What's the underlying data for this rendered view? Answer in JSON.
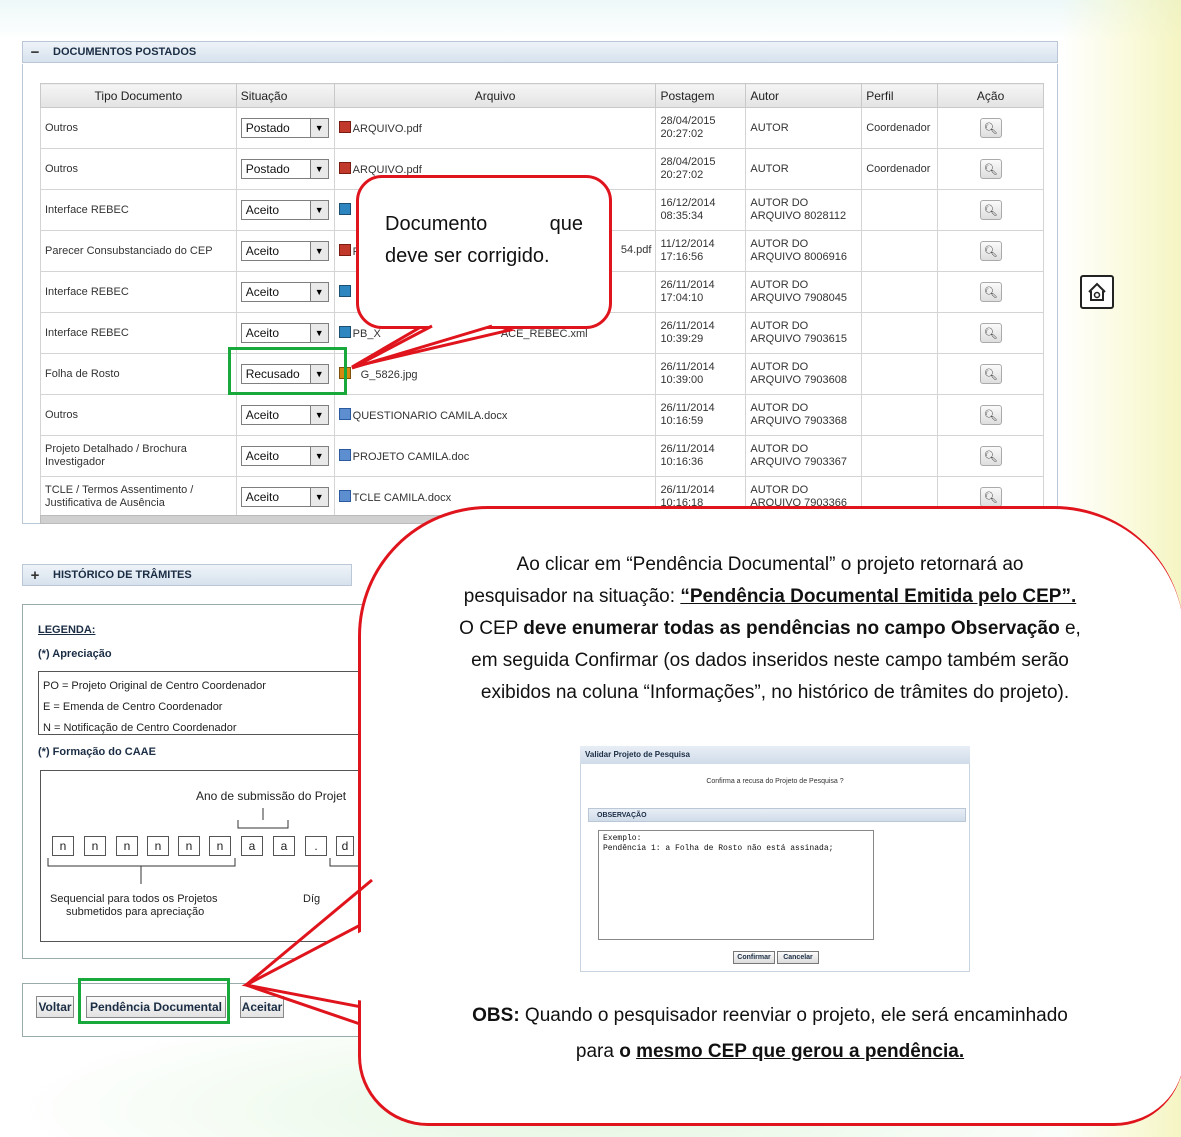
{
  "sections": {
    "docs_title": "DOCUMENTOS POSTADOS",
    "docs_toggle": "−",
    "hist_title": "HISTÓRICO DE TRÂMITES",
    "hist_toggle": "+"
  },
  "table": {
    "headers": [
      "Tipo Documento",
      "Situação",
      "Arquivo",
      "Postagem",
      "Autor",
      "Perfil",
      "Ação"
    ],
    "rows": [
      {
        "tipo": "Outros",
        "situacao": "Postado",
        "arquivo": "ARQUIVO.pdf",
        "icon": "pdf-icon",
        "data": "28/04/2015",
        "hora": "20:27:02",
        "autor1": "AUTOR",
        "autor2": "",
        "perfil": "Coordenador"
      },
      {
        "tipo": "Outros",
        "situacao": "Postado",
        "arquivo": "ARQUIVO.pdf",
        "icon": "pdf-icon",
        "data": "28/04/2015",
        "hora": "20:27:02",
        "autor1": "AUTOR",
        "autor2": "",
        "perfil": "Coordenador"
      },
      {
        "tipo": "Interface REBEC",
        "situacao": "Aceito",
        "arquivo": "",
        "icon": "xml-icon",
        "data": "16/12/2014",
        "hora": "08:35:34",
        "autor1": "AUTOR DO",
        "autor2": "ARQUIVO 8028112",
        "perfil": ""
      },
      {
        "tipo": "Parecer Consubstanciado do CEP",
        "situacao": "Aceito",
        "arquivo": "PI",
        "arquivo_end": "54.pdf",
        "icon": "pdf-icon",
        "data": "11/12/2014",
        "hora": "17:16:56",
        "autor1": "AUTOR DO",
        "autor2": "ARQUIVO 8006916",
        "perfil": ""
      },
      {
        "tipo": "Interface REBEC",
        "situacao": "Aceito",
        "arquivo": "",
        "icon": "xml-icon",
        "data": "26/11/2014",
        "hora": "17:04:10",
        "autor1": "AUTOR DO",
        "autor2": "ARQUIVO 7908045",
        "perfil": ""
      },
      {
        "tipo": "Interface REBEC",
        "situacao": "Aceito",
        "arquivo": "PB_X",
        "arquivo_end": "ACE_REBEC.xml",
        "icon": "xml-icon",
        "data": "26/11/2014",
        "hora": "10:39:29",
        "autor1": "AUTOR DO",
        "autor2": "ARQUIVO 7903615",
        "perfil": ""
      },
      {
        "tipo": "Folha de Rosto",
        "situacao": "Recusado",
        "arquivo": "G_5826.jpg",
        "icon": "image-icon",
        "data": "26/11/2014",
        "hora": "10:39:00",
        "autor1": "AUTOR DO",
        "autor2": "ARQUIVO 7903608",
        "perfil": ""
      },
      {
        "tipo": "Outros",
        "situacao": "Aceito",
        "arquivo": "QUESTIONARIO CAMILA.docx",
        "icon": "doc-icon",
        "data": "26/11/2014",
        "hora": "10:16:59",
        "autor1": "AUTOR DO",
        "autor2": "ARQUIVO 7903368",
        "perfil": ""
      },
      {
        "tipo": "Projeto Detalhado / Brochura Investigador",
        "situacao": "Aceito",
        "arquivo": "PROJETO CAMILA.doc",
        "icon": "doc-icon",
        "data": "26/11/2014",
        "hora": "10:16:36",
        "autor1": "AUTOR DO",
        "autor2": "ARQUIVO 7903367",
        "perfil": ""
      },
      {
        "tipo": "TCLE / Termos Assentimento / Justificativa de Ausência",
        "situacao": "Aceito",
        "arquivo": "TCLE CAMILA.docx",
        "icon": "doc-icon",
        "data": "26/11/2014",
        "hora": "10:16:18",
        "autor1": "AUTOR DO",
        "autor2": "ARQUIVO 7903366",
        "perfil": ""
      }
    ]
  },
  "callout1": {
    "word1": "Documento",
    "word2": "que",
    "line2": "deve ser corrigido."
  },
  "legend": {
    "title": "LEGENDA:",
    "apreciacao_title": "(*) Apreciação",
    "items": [
      "PO = Projeto Original de Centro Coordenador",
      "E = Emenda de Centro Coordenador",
      "N = Notificação de Centro Coordenador"
    ],
    "caae_title": "(*) Formação do CAAE",
    "ano_label": "Ano de submissão do Projet",
    "cells": [
      "n",
      "n",
      "n",
      "n",
      "n",
      "n",
      "a",
      "a",
      ".",
      "d"
    ],
    "seq_line1": "Sequencial para todos os Projetos",
    "seq_line2": "submetidos para apreciação",
    "dig_label": "Díg"
  },
  "buttons": {
    "voltar": "Voltar",
    "pendencia": "Pendência Documental",
    "aceitar": "Aceitar"
  },
  "callout2": {
    "p1_a": "Ao clicar em “Pendência Documental” o projeto retornará ao",
    "p1_b": "pesquisador na situação:",
    "p1_b_bold": "“Pendência Documental Emitida pelo CEP”.",
    "p1_c1": "O CEP",
    "p1_c_bold": "deve enumerar todas as pendências no campo Observação",
    "p1_c2": "e,",
    "p1_d": "em seguida Confirmar (os dados inseridos neste campo também serão",
    "p1_e": "exibidos na coluna “Informações”, no histórico de trâmites do projeto).",
    "obs_bold": "OBS:",
    "obs_a": "Quando o pesquisador reenviar o projeto, ele será encaminhado",
    "obs_b1": "para",
    "obs_b_bold1": "o",
    "obs_b_bold2": "mesmo CEP que gerou a pendência."
  },
  "mini_dialog": {
    "title": "Validar Projeto de Pesquisa",
    "question": "Confirma a recusa do Projeto de Pesquisa ?",
    "section": "OBSERVAÇÃO",
    "textarea": "Exemplo:\nPendência 1: a Folha de Rosto não está assinada;",
    "confirm": "Confirmar",
    "cancel": "Cancelar"
  }
}
